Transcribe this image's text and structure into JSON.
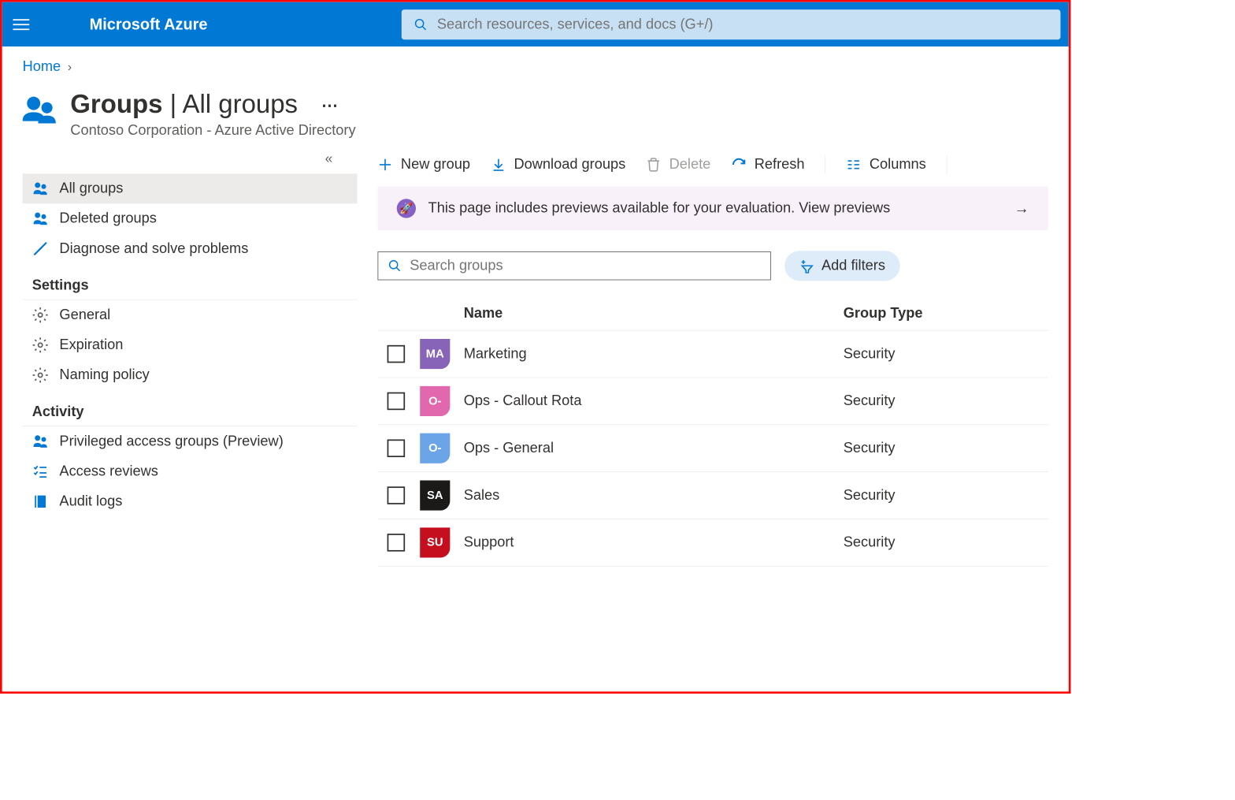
{
  "brand": "Microsoft Azure",
  "global_search_placeholder": "Search resources, services, and docs (G+/)",
  "breadcrumb": {
    "home": "Home"
  },
  "header": {
    "title_bold": "Groups",
    "title_thin": "All groups",
    "subtitle": "Contoso Corporation - Azure Active Directory"
  },
  "sidebar": {
    "nav": [
      {
        "label": "All groups"
      },
      {
        "label": "Deleted groups"
      },
      {
        "label": "Diagnose and solve problems"
      }
    ],
    "settings_header": "Settings",
    "settings": [
      {
        "label": "General"
      },
      {
        "label": "Expiration"
      },
      {
        "label": "Naming policy"
      }
    ],
    "activity_header": "Activity",
    "activity": [
      {
        "label": "Privileged access groups (Preview)"
      },
      {
        "label": "Access reviews"
      },
      {
        "label": "Audit logs"
      }
    ]
  },
  "toolbar": {
    "new_group": "New group",
    "download": "Download groups",
    "delete": "Delete",
    "refresh": "Refresh",
    "columns": "Columns"
  },
  "banner": {
    "text": "This page includes previews available for your evaluation. View previews"
  },
  "filter": {
    "search_placeholder": "Search groups",
    "add_filters": "Add filters"
  },
  "table": {
    "headers": {
      "name": "Name",
      "type": "Group Type"
    },
    "rows": [
      {
        "initials": "MA",
        "color": "#8764b8",
        "name": "Marketing",
        "type": "Security"
      },
      {
        "initials": "O-",
        "color": "#e268ad",
        "name": "Ops - Callout Rota",
        "type": "Security"
      },
      {
        "initials": "O-",
        "color": "#6ba5e7",
        "name": "Ops - General",
        "type": "Security"
      },
      {
        "initials": "SA",
        "color": "#1b1a19",
        "name": "Sales",
        "type": "Security"
      },
      {
        "initials": "SU",
        "color": "#c50f1f",
        "name": "Support",
        "type": "Security"
      }
    ]
  }
}
